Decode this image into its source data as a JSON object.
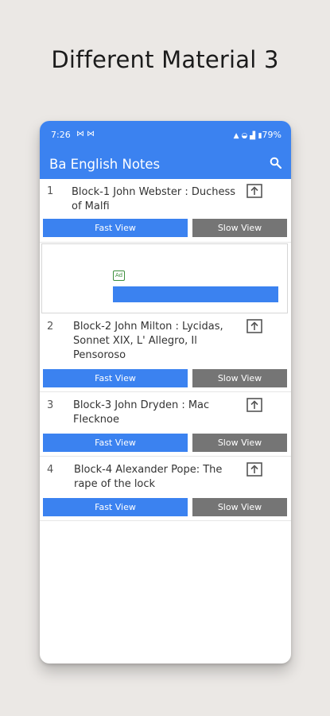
{
  "page": {
    "headline": "Different Material 3"
  },
  "status_bar": {
    "time": "7:26",
    "battery": "79%"
  },
  "app_bar": {
    "title": "Ba English Notes"
  },
  "buttons": {
    "fast_view": "Fast View",
    "slow_view": "Slow View"
  },
  "ad": {
    "badge": "Ad"
  },
  "items": [
    {
      "number": "1",
      "title": "Block-1 John Webster : Duchess of Malfi"
    },
    {
      "number": "2",
      "title": "Block-2 John Milton : Lycidas, Sonnet XIX, L' Allegro, Il Pensoroso"
    },
    {
      "number": "3",
      "title": "Block-3 John Dryden : Mac Flecknoe"
    },
    {
      "number": "4",
      "title": "Block-4 Alexander Pope: The rape of the lock"
    }
  ],
  "colors": {
    "primary": "#3b82f0",
    "slow_button": "#757575",
    "background": "#ebe8e5"
  }
}
